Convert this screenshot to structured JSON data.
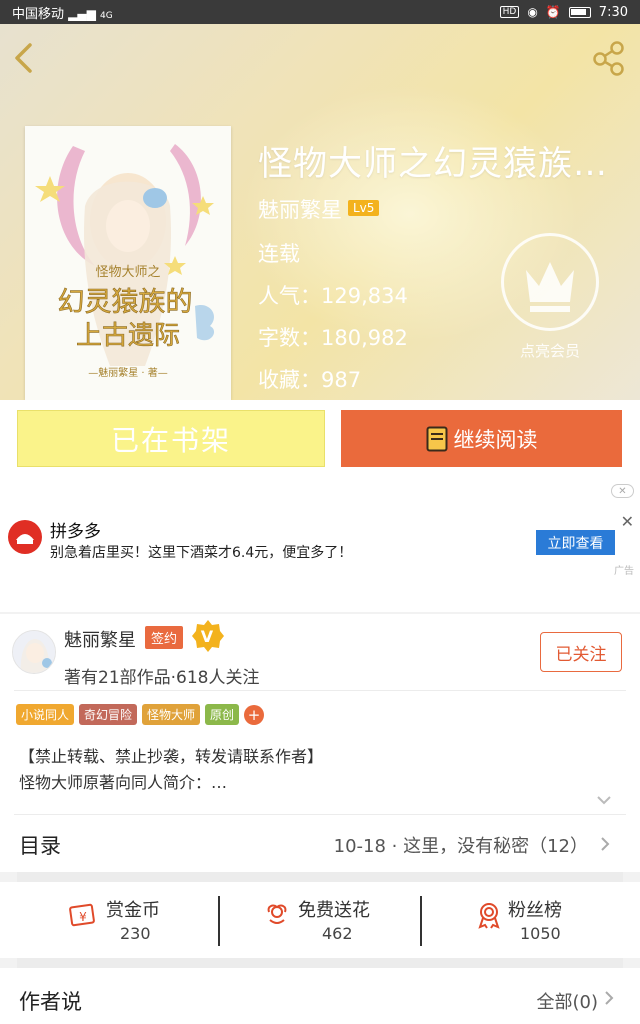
{
  "status_bar": {
    "carrier": "中国移动",
    "signal_text": "4G",
    "hd_label": "HD",
    "time": "7:30"
  },
  "book": {
    "title": "怪物大师之幻灵猿族的…",
    "author": "魅丽繁星",
    "author_level": "Lv5",
    "status": "连载",
    "popularity_label": "人气：",
    "popularity": "129,834",
    "words_label": "字数：",
    "words": "180,982",
    "favorites_label": "收藏：",
    "favorites": "987"
  },
  "vip": {
    "label": "点亮会员"
  },
  "actions": {
    "shelf_label": "已在书架",
    "read_label": "继续阅读"
  },
  "ad": {
    "advertiser": "拼多多",
    "description": "别急着店里买！这里下酒菜才6.4元，便宜多了！",
    "cta": "立即查看",
    "tag": "广告"
  },
  "author_card": {
    "name": "魅丽繁星",
    "sign_badge": "签约",
    "stats": "著有21部作品·618人关注",
    "follow_label": "已关注",
    "tags": [
      {
        "label": "小说同人",
        "color": "#f0a830"
      },
      {
        "label": "奇幻冒险",
        "color": "#c2695a"
      },
      {
        "label": "怪物大师",
        "color": "#e0a23a"
      },
      {
        "label": "原创",
        "color": "#8cb84a"
      }
    ],
    "tag_add": "+",
    "intro_line1": "【禁止转载、禁止抄袭，转发请联系作者】",
    "intro_line2": "怪物大师原著向同人简介：…"
  },
  "toc": {
    "label": "目录",
    "latest": "10-18 · 这里，没有秘密（12）"
  },
  "gifts": [
    {
      "label": "赏金币",
      "count": "230",
      "icon": "reward-coin-icon"
    },
    {
      "label": "免费送花",
      "count": "462",
      "icon": "flower-icon"
    },
    {
      "label": "粉丝榜",
      "count": "1050",
      "icon": "medal-icon"
    }
  ],
  "author_says": {
    "label": "作者说",
    "all_label": "全部(0)"
  },
  "colors": {
    "accent": "#ea6a3c",
    "shelf": "#faf38a",
    "cta_blue": "#2a7bd7",
    "lv": "#f3b21d"
  }
}
